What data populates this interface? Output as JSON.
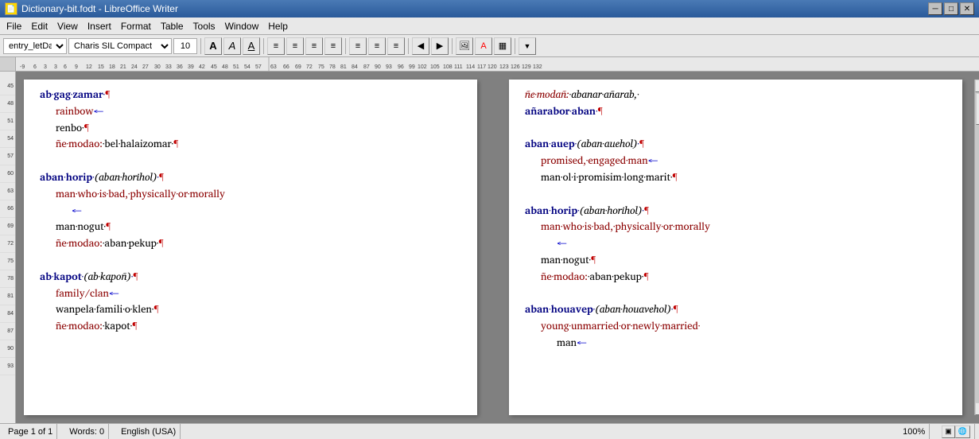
{
  "titlebar": {
    "title": "Dictionary-bit.fodt - LibreOffice Writer",
    "icon": "📄"
  },
  "menubar": {
    "items": [
      "File",
      "Edit",
      "View",
      "Insert",
      "Format",
      "Table",
      "Tools",
      "Window",
      "Help"
    ]
  },
  "toolbar": {
    "style_select": "entry_letData_dicBody",
    "font_select": "Charis SIL Compact",
    "font_size": "10",
    "buttons": [
      "A",
      "A",
      "A",
      "≡",
      "≡",
      "≡",
      "≡",
      "≡",
      "≡",
      "≡",
      "◀",
      "▶",
      "🖼",
      "A",
      "▦"
    ]
  },
  "ruler": {
    "marks": [
      "-9",
      "6",
      "3",
      "3",
      "6",
      "9",
      "12",
      "15",
      "18",
      "21",
      "24",
      "27",
      "30",
      "33",
      "36",
      "39",
      "42",
      "45",
      "48",
      "51",
      "54",
      "57",
      "63",
      "66",
      "69",
      "72",
      "75",
      "78",
      "81",
      "84",
      "87",
      "90",
      "93",
      "96",
      "99",
      "102",
      "105",
      "108",
      "111",
      "114",
      "117",
      "120",
      "123",
      "126",
      "129",
      "132"
    ]
  },
  "side_ruler": {
    "marks": [
      "45",
      "48",
      "51",
      "54",
      "57",
      "60",
      "63",
      "66",
      "69",
      "72",
      "75",
      "78",
      "81",
      "84",
      "87",
      "90",
      "93"
    ]
  },
  "left_column": {
    "entries": [
      {
        "head": "ab·gag·zamar·¶",
        "lines": [
          {
            "text": "rainbow←",
            "type": "def"
          },
          {
            "text": "renbo·¶",
            "type": "def"
          },
          {
            "text": "ñe·modao:·bel·halaizomar·¶",
            "type": "def"
          }
        ]
      },
      {
        "head": "aban·horip·",
        "head_italic": "(aban·horihol)·¶",
        "lines": [
          {
            "text": "man·who·is·bad,·physically·or·morally",
            "type": "def"
          },
          {
            "text": "←",
            "type": "def2"
          },
          {
            "text": "man·nogut·¶",
            "type": "def"
          },
          {
            "text": "ñe·modao:·aban·pekup·¶",
            "type": "def"
          }
        ]
      },
      {
        "head": "ab·kapot·",
        "head_italic": "(ab·kapoñ)·¶",
        "lines": [
          {
            "text": "family/clan←",
            "type": "def"
          },
          {
            "text": "wanpela·famili·o·klen·¶",
            "type": "def"
          },
          {
            "text": "ñe·modao:·kapot·¶",
            "type": "def"
          }
        ]
      }
    ]
  },
  "right_column": {
    "entries": [
      {
        "prefix": "ñe·modañ:·",
        "head": "abanar·añarab,·añarabor·aban·¶",
        "head_type": "continuation"
      },
      {
        "head": "aban·auep·",
        "head_italic": "(aban·auehol)·¶",
        "lines": [
          {
            "text": "promised,·engaged·man←",
            "type": "def"
          },
          {
            "text": "man·ol·i·promisim·long·marit·¶",
            "type": "def"
          }
        ]
      },
      {
        "head": "aban·horip·",
        "head_italic": "(aban·horihol)·¶",
        "lines": [
          {
            "text": "man·who·is·bad,·physically·or·morally",
            "type": "def"
          },
          {
            "text": "←",
            "type": "def2"
          },
          {
            "text": "man·nogut·¶",
            "type": "def"
          },
          {
            "text": "ñe·modao:·aban·pekup·¶",
            "type": "def"
          }
        ]
      },
      {
        "head": "aban·houavep·",
        "head_italic": "(aban·houavehol)·¶",
        "lines": [
          {
            "text": "young·unmarried·or·newly·married·",
            "type": "def"
          },
          {
            "text": "man←",
            "type": "def2"
          }
        ]
      }
    ]
  },
  "statusbar": {
    "page_info": "Page 1 of 1",
    "words": "Words: 0",
    "lang": "English (USA)",
    "view": "100%"
  }
}
